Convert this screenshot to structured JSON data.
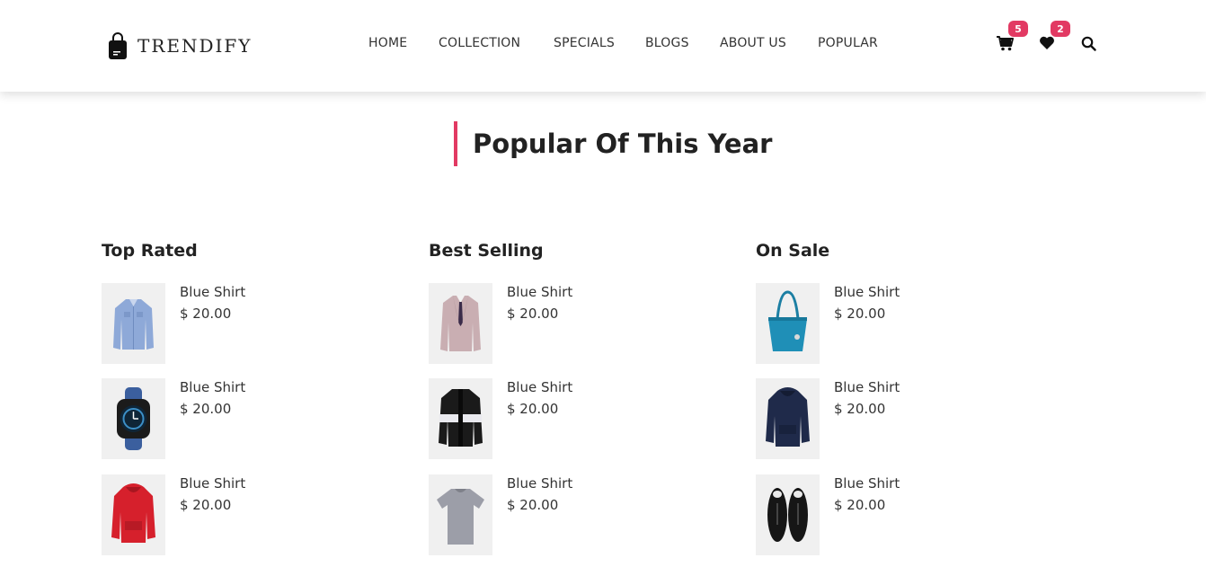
{
  "brand": {
    "name": "TRENDIFY",
    "logo_icon": "shopping-bag-icon"
  },
  "nav": {
    "items": [
      {
        "label": "HOME"
      },
      {
        "label": "COLLECTION"
      },
      {
        "label": "SPECIALS"
      },
      {
        "label": "BLOGS"
      },
      {
        "label": "ABOUT US"
      },
      {
        "label": "POPULAR"
      }
    ]
  },
  "header_icons": {
    "cart": {
      "icon": "cart-icon",
      "count": "5"
    },
    "wishlist": {
      "icon": "heart-icon",
      "count": "2"
    },
    "search": {
      "icon": "search-icon"
    }
  },
  "accent_color": "#e23a63",
  "section": {
    "title": "Popular Of This Year"
  },
  "columns": [
    {
      "title": "Top Rated",
      "items": [
        {
          "name": "Blue Shirt",
          "price": "$ 20.00",
          "image": "blue-shirt-image"
        },
        {
          "name": "Blue Shirt",
          "price": "$ 20.00",
          "image": "smartwatch-image"
        },
        {
          "name": "Blue Shirt",
          "price": "$ 20.00",
          "image": "red-hoodie-image"
        }
      ]
    },
    {
      "title": "Best Selling",
      "items": [
        {
          "name": "Blue Shirt",
          "price": "$ 20.00",
          "image": "suit-jacket-image"
        },
        {
          "name": "Blue Shirt",
          "price": "$ 20.00",
          "image": "black-cardigan-image"
        },
        {
          "name": "Blue Shirt",
          "price": "$ 20.00",
          "image": "grey-tshirt-image"
        }
      ]
    },
    {
      "title": "On Sale",
      "items": [
        {
          "name": "Blue Shirt",
          "price": "$ 20.00",
          "image": "teal-handbag-image"
        },
        {
          "name": "Blue Shirt",
          "price": "$ 20.00",
          "image": "navy-hoodie-image"
        },
        {
          "name": "Blue Shirt",
          "price": "$ 20.00",
          "image": "black-sneakers-image"
        }
      ]
    }
  ]
}
